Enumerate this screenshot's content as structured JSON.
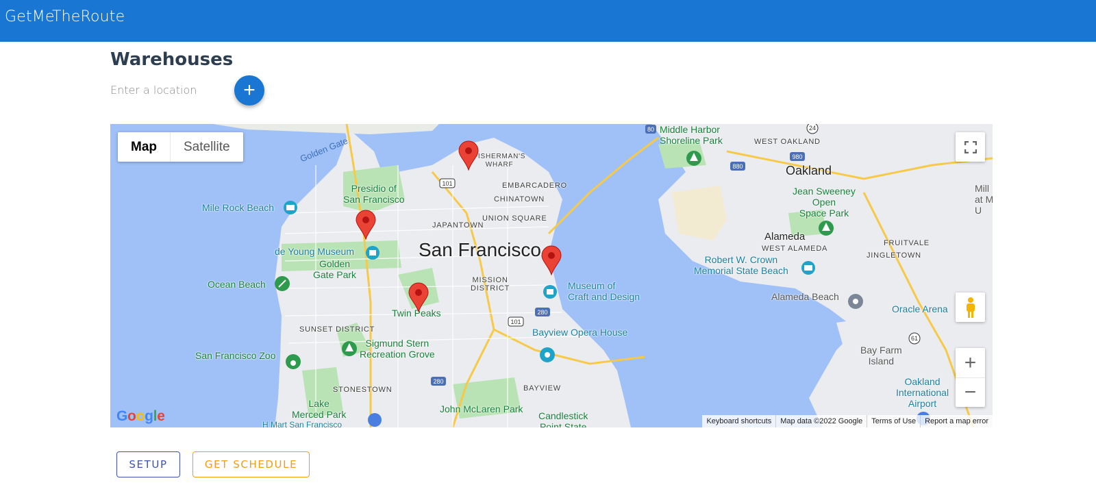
{
  "app": {
    "title": "GetMeTheRoute"
  },
  "page": {
    "title": "Warehouses"
  },
  "location": {
    "placeholder": "Enter a location",
    "value": ""
  },
  "add_button": {
    "label": "+",
    "icon": "plus-icon"
  },
  "map": {
    "map_types": [
      "Map",
      "Satellite"
    ],
    "selected_map_type": "Map",
    "zoom_in_label": "+",
    "zoom_out_label": "−",
    "logo": "Google",
    "attribution": [
      "Keyboard shortcuts",
      "Map data ©2022 Google",
      "Terms of Use",
      "Report a map error"
    ],
    "labels": {
      "city": "San Francisco",
      "oakland": "Oakland",
      "alameda": "Alameda",
      "golden_gate": "Golden Gate",
      "middle_harbor": "Middle Harbor\nShoreline Park",
      "west_oakland": "WEST OAKLAND",
      "jean_sweeney": "Jean Sweeney\nOpen\nSpace Park",
      "mill": "Mill\nat M\nU",
      "fishermans_wharf": "FISHERMAN'S\nWHARF",
      "embarcadero": "EMBARCADERO",
      "chinatown": "CHINATOWN",
      "union_square": "UNION SQUARE",
      "japantown": "JAPANTOWN",
      "presidio": "Presidio of\nSan Francisco",
      "mile_rock": "Mile Rock Beach",
      "de_young": "de Young Museum",
      "golden_gate_park": "Golden\nGate Park",
      "ocean_beach": "Ocean Beach",
      "mission": "MISSION\nDISTRICT",
      "museum_craft": "Museum of\nCraft and Design",
      "west_alameda": "WEST ALAMEDA",
      "fruitvale": "FRUITVALE",
      "jingletown": "JINGLETOWN",
      "robert_crown": "Robert W. Crown\nMemorial State Beach",
      "alameda_beach": "Alameda Beach",
      "oracle": "Oracle Arena",
      "twin_peaks": "Twin Peaks",
      "sunset": "SUNSET DISTRICT",
      "sigmund": "Sigmund Stern\nRecreation Grove",
      "sf_zoo": "San Francisco Zoo",
      "bayview_opera": "Bayview Opera House",
      "bay_farm": "Bay Farm\nIsland",
      "oakland_airport": "Oakland\nInternational\nAirport",
      "stonestown": "STONESTOWN",
      "bayview": "BAYVIEW",
      "lake_merced": "Lake\nMerced Park",
      "john_mclaren": "John McLaren Park",
      "candlestick": "Candlestick\nPoint State",
      "hmart": "H Mart San Francisco"
    },
    "highway_shields": [
      "80",
      "24",
      "980",
      "880",
      "101",
      "101",
      "280",
      "61",
      "280"
    ],
    "markers": [
      "warehouse-1",
      "warehouse-2",
      "warehouse-3",
      "warehouse-4"
    ]
  },
  "actions": {
    "setup_label": "SETUP",
    "schedule_label": "GET SCHEDULE"
  }
}
